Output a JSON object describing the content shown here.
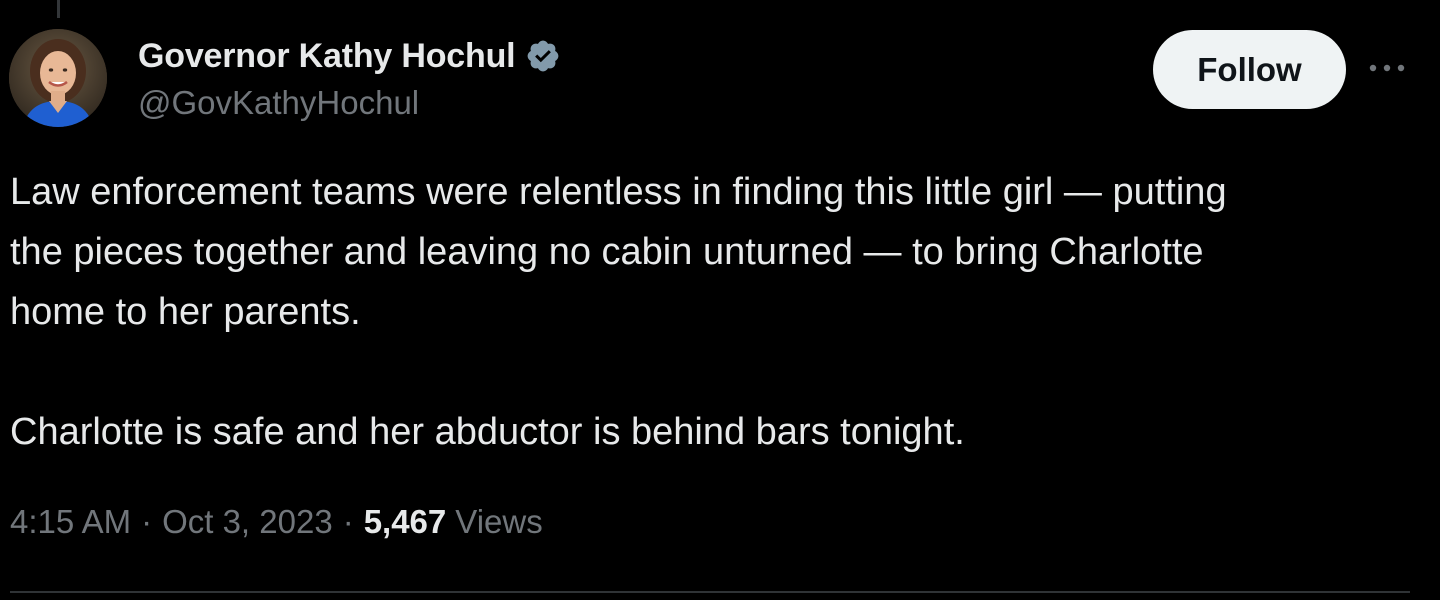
{
  "tweet": {
    "author": {
      "display_name": "Governor Kathy Hochul",
      "handle": "@GovKathyHochul",
      "verified": true,
      "verified_badge_icon": "verified-badge-icon",
      "verified_badge_color": "#829aab"
    },
    "follow_label": "Follow",
    "more_icon": "more-options-icon",
    "text_lines": [
      "Law enforcement teams were relentless in finding this little girl — putting",
      "the pieces together and leaving no cabin unturned — to bring Charlotte",
      "home to her parents.",
      "Charlotte is safe and her abductor is behind bars tonight."
    ],
    "time": "4:15 AM",
    "separator": "·",
    "date": "Oct 3, 2023",
    "views_count": "5,467",
    "views_label": "Views"
  },
  "colors": {
    "background": "#000000",
    "primary_text": "#e7e9ea",
    "secondary_text": "#71767b",
    "follow_button_bg": "#eff3f4",
    "divider": "#2f3336"
  }
}
